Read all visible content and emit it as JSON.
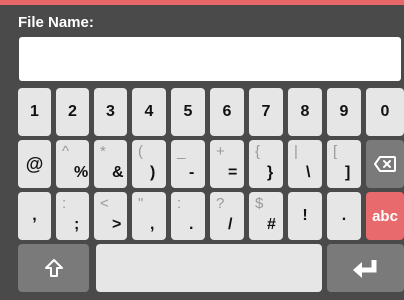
{
  "label": "File Name:",
  "field": {
    "value": ""
  },
  "rows": {
    "r1": [
      "1",
      "2",
      "3",
      "4",
      "5",
      "6",
      "7",
      "8",
      "9",
      "0"
    ],
    "r2": [
      {
        "main": "@",
        "sub": ""
      },
      {
        "main": "%",
        "sub": "^"
      },
      {
        "main": "&",
        "sub": "*"
      },
      {
        "main": ")",
        "sub": "("
      },
      {
        "main": "-",
        "sub": "_"
      },
      {
        "main": "=",
        "sub": "+"
      },
      {
        "main": "}",
        "sub": "{"
      },
      {
        "main": "\\",
        "sub": "|"
      },
      {
        "main": "]",
        "sub": "["
      }
    ],
    "r3": [
      {
        "main": ",",
        "sub": ""
      },
      {
        "main": ";",
        "sub": ":"
      },
      {
        "main": ">",
        "sub": "<"
      },
      {
        "main": ",",
        "sub": "\""
      },
      {
        "main": ".",
        "sub": ":"
      },
      {
        "main": "/",
        "sub": "?"
      },
      {
        "main": "#",
        "sub": "$"
      },
      {
        "main": "!",
        "sub": ""
      },
      {
        "main": ".",
        "sub": ""
      }
    ],
    "abc": "abc"
  },
  "icons": {
    "backspace": "backspace-icon",
    "shift": "shift-icon",
    "enter": "enter-icon"
  },
  "colors": {
    "accent": "#e8686a",
    "keyboard_bg": "#4a4a4a",
    "key": "#e6e6e6",
    "dark_key": "#7a7a7a"
  }
}
